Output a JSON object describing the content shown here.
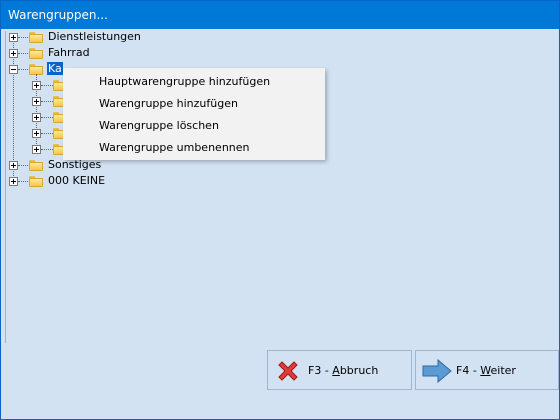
{
  "window": {
    "title": "Warengruppen..."
  },
  "tree": {
    "items": [
      {
        "label": "Dienstleistungen",
        "expanded": false
      },
      {
        "label": "Fahrrad",
        "expanded": false
      },
      {
        "label": "Kabel",
        "expanded": true,
        "selected": true,
        "visible_text": "Ka"
      },
      {
        "label": "Sonstiges",
        "expanded": false
      },
      {
        "label": "000 KEINE",
        "expanded": false
      }
    ]
  },
  "context_menu": {
    "items": [
      "Hauptwarengruppe hinzufügen",
      "Warengruppe hinzufügen",
      "Warengruppe löschen",
      "Warengruppe umbenennen"
    ]
  },
  "buttons": {
    "cancel": {
      "prefix": "F3 - ",
      "hotkey": "A",
      "rest": "bbruch"
    },
    "next": {
      "prefix": "F4 - ",
      "hotkey": "W",
      "rest": "eiter"
    }
  },
  "colors": {
    "titlebar": "#0078d7",
    "client": "#d3e2f3",
    "selection": "#0a64c8"
  }
}
